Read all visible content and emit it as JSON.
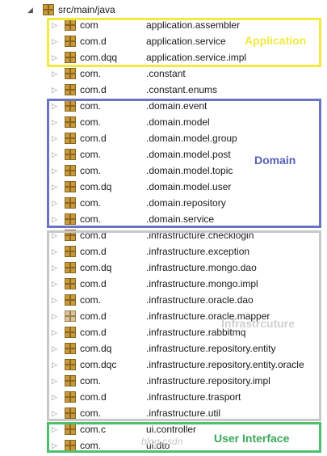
{
  "tree": {
    "root": {
      "label": "src/main/java"
    },
    "rows": [
      {
        "prefix": "com",
        "suffix": "application.assembler"
      },
      {
        "prefix": "com.d",
        "suffix": "application.service"
      },
      {
        "prefix": "com.dqq",
        "suffix": "application.service.impl"
      },
      {
        "prefix": "com.",
        "suffix": ".constant"
      },
      {
        "prefix": "com.d",
        "suffix": ".constant.enums"
      },
      {
        "prefix": "com.",
        "suffix": ".domain.event"
      },
      {
        "prefix": "com.",
        "suffix": ".domain.model"
      },
      {
        "prefix": "com.d",
        "suffix": ".domain.model.group"
      },
      {
        "prefix": "com.",
        "suffix": ".domain.model.post"
      },
      {
        "prefix": "com.",
        "suffix": ".domain.model.topic"
      },
      {
        "prefix": "com.dq",
        "suffix": ".domain.model.user"
      },
      {
        "prefix": "com.",
        "suffix": ".domain.repository"
      },
      {
        "prefix": "com.",
        "suffix": ".domain.service"
      },
      {
        "prefix": "com.d",
        "suffix": ".infrastructure.checklogin"
      },
      {
        "prefix": "com.d",
        "suffix": ".infrastructure.exception"
      },
      {
        "prefix": "com.dq",
        "suffix": ".infrastructure.mongo.dao"
      },
      {
        "prefix": "com.d",
        "suffix": ".infrastructure.mongo.impl"
      },
      {
        "prefix": "com.",
        "suffix": ".infrastructure.oracle.dao"
      },
      {
        "prefix": "com.d",
        "suffix": ".infrastructure.oracle.mapper"
      },
      {
        "prefix": "com.d",
        "suffix": ".infrastructure.rabbitmq"
      },
      {
        "prefix": "com.dq",
        "suffix": ".infrastructure.repository.entity"
      },
      {
        "prefix": "com.dqc",
        "suffix": ".infrastructure.repository.entity.oracle"
      },
      {
        "prefix": "com.",
        "suffix": ".infrastructure.repository.impl"
      },
      {
        "prefix": "com.d",
        "suffix": ".infrastructure.trasport"
      },
      {
        "prefix": "com.",
        "suffix": ".infrastructure.util"
      },
      {
        "prefix": "com.c",
        "suffix": "ui.controller"
      },
      {
        "prefix": "com.",
        "suffix": "ui.dto"
      }
    ]
  },
  "layers": {
    "application": {
      "label": "Application",
      "color": "#f2ea40"
    },
    "domain": {
      "label": "Domain",
      "color": "#6a74c4"
    },
    "infrastructure": {
      "label": "Infrastrcuture",
      "color": "#c8c8c8"
    },
    "ui": {
      "label": "User Interface",
      "color": "#4fbf6e"
    }
  },
  "watermark": "blog.csdn"
}
